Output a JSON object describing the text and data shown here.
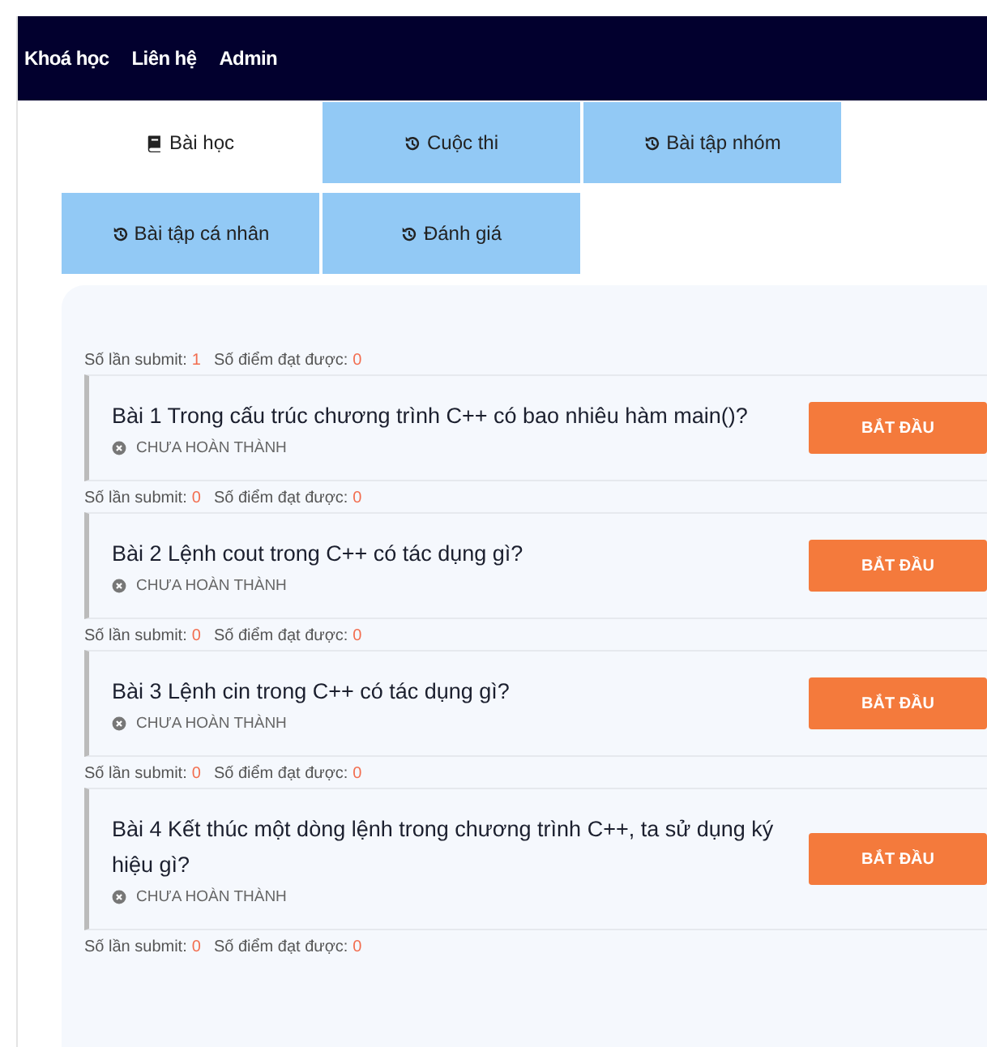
{
  "nav": {
    "links": [
      "Khoá học",
      "Liên hệ",
      "Admin"
    ]
  },
  "tabs": [
    {
      "label": "Bài học",
      "kind": "book",
      "selected": true
    },
    {
      "label": "Cuộc thi",
      "kind": "history",
      "selected": false
    },
    {
      "label": "Bài tập nhóm",
      "kind": "history",
      "selected": false
    },
    {
      "label": "Bài tập cá nhân",
      "kind": "history",
      "selected": false
    },
    {
      "label": "Đánh giá",
      "kind": "history",
      "selected": false
    }
  ],
  "lessons": [
    {
      "submit_label": "Số lần submit:",
      "submits": "1",
      "score_label": "Số điểm đạt được:",
      "score": "0",
      "title": "Bài 1 Trong cấu trúc chương trình C++ có bao nhiêu hàm main()?",
      "status": "CHƯA HOÀN THÀNH",
      "completed": false,
      "button": "BẮT ĐẦU"
    },
    {
      "submit_label": "Số lần submit:",
      "submits": "0",
      "score_label": "Số điểm đạt được:",
      "score": "0",
      "title": "Bài 2 Lệnh cout trong C++ có tác dụng gì?",
      "status": "CHƯA HOÀN THÀNH",
      "completed": false,
      "button": "BẮT ĐẦU"
    },
    {
      "submit_label": "Số lần submit:",
      "submits": "0",
      "score_label": "Số điểm đạt được:",
      "score": "0",
      "title": "Bài 3 Lệnh cin trong C++ có tác dụng gì?",
      "status": "CHƯA HOÀN THÀNH",
      "completed": false,
      "button": "BẮT ĐẦU"
    },
    {
      "submit_label": "Số lần submit:",
      "submits": "0",
      "score_label": "Số điểm đạt được:",
      "score": "0",
      "title": "Bài 4 Kết thúc một dòng lệnh trong chương trình C++, ta sử dụng ký hiệu gì?",
      "status": "CHƯA HOÀN THÀNH",
      "completed": false,
      "button": "BẮT ĐẦU"
    }
  ],
  "next_lesson_meta": {
    "submit_label": "Số lần submit:",
    "submits": "0",
    "score_label": "Số điểm đạt được:",
    "score": "0"
  }
}
